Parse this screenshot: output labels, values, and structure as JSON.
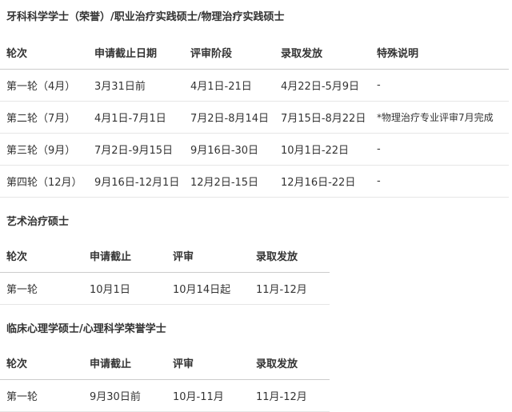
{
  "section1": {
    "title": "牙科科学学士（荣誉）/职业治疗实践硕士/物理治疗实践硕士",
    "headers": [
      "轮次",
      "申请截止日期",
      "评审阶段",
      "录取发放",
      "特殊说明"
    ],
    "rows": [
      [
        "第一轮（4月）",
        "3月31日前",
        "4月1日-21日",
        "4月22日-5月9日",
        "-"
      ],
      [
        "第二轮（7月）",
        "4月1日-7月1日",
        "7月2日-8月14日",
        "7月15日-8月22日",
        "*物理治疗专业评审7月完成"
      ],
      [
        "第三轮（9月）",
        "7月2日-9月15日",
        "9月16日-30日",
        "10月1日-22日",
        "-"
      ],
      [
        "第四轮（12月）",
        "9月16日-12月1日",
        "12月2日-15日",
        "12月16日-22日",
        "-"
      ]
    ]
  },
  "section2": {
    "title": "艺术治疗硕士",
    "headers": [
      "轮次",
      "申请截止",
      "评审",
      "录取发放"
    ],
    "rows": [
      [
        "第一轮",
        "10月1日",
        "10月14日起",
        "11月-12月"
      ]
    ]
  },
  "section3": {
    "title": "临床心理学硕士/心理科学荣誉学士",
    "headers": [
      "轮次",
      "申请截止",
      "评审",
      "录取发放"
    ],
    "rows": [
      [
        "第一轮",
        "9月30日前",
        "10月-11月",
        "11月-12月"
      ]
    ]
  }
}
